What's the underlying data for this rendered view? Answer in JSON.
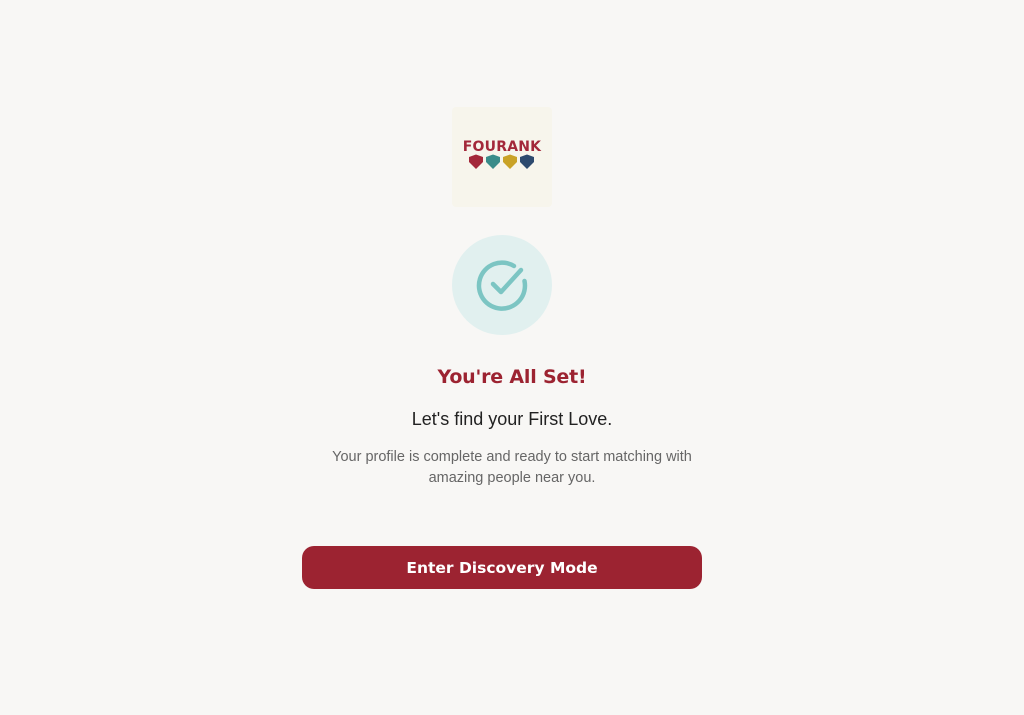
{
  "brand": {
    "name": "FOURANK",
    "icon": "four-hearts-logo",
    "heart_colors": [
      "#a3283a",
      "#3a8c8a",
      "#c9a227",
      "#2d4a6e"
    ]
  },
  "success": {
    "icon": "check-circle-icon",
    "icon_color": "#7cc5c3",
    "circle_color": "#e1f0ef"
  },
  "content": {
    "title": "You're All Set!",
    "subtitle": "Let's find your First Love.",
    "description": "Your profile is complete and ready to start matching with amazing people near you."
  },
  "actions": {
    "primary_label": "Enter Discovery Mode"
  },
  "colors": {
    "accent": "#9c2331",
    "background": "#f8f7f5",
    "text_primary": "#222222",
    "text_secondary": "#666666"
  }
}
